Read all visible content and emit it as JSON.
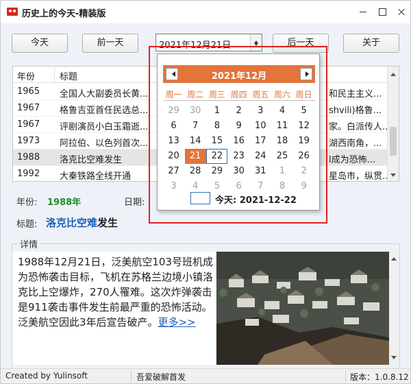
{
  "window": {
    "title": "历史上的今天-精装版"
  },
  "toolbar": {
    "today_label": "今天",
    "prev_label": "前一天",
    "date_value": "2021年12月21日",
    "next_label": "后一天",
    "about_label": "关于"
  },
  "table": {
    "headers": {
      "year": "年份",
      "title": "标题"
    },
    "rows": [
      {
        "year": "1965",
        "title": "全国人大副委员长黄...",
        "right": "和民主主义..."
      },
      {
        "year": "1967",
        "title": "格鲁吉亚首任民选总...",
        "right": "shvili)格鲁..."
      },
      {
        "year": "1967",
        "title": "评剧演员小白玉霜逝...",
        "right": "家。白派传人..."
      },
      {
        "year": "1973",
        "title": "阿拉伯、以色列首次...",
        "right": "湖西南角，..."
      },
      {
        "year": "1988",
        "title": "洛克比空难发生",
        "right": "l成为恐怖..."
      },
      {
        "year": "1992",
        "title": "大秦铁路全线开通",
        "right": "星岛市，纵贯..."
      }
    ],
    "selected_index": 4
  },
  "info": {
    "year_label": "年份:",
    "year_value": "1988年",
    "date_label": "日期:",
    "title_label": "标题:",
    "title_highlight": "洛克比空难",
    "title_rest": "发生"
  },
  "details": {
    "legend": "详情",
    "text": "1988年12月21日，泛美航空103号班机成为恐怖袭击目标，飞机在苏格兰边境小镇洛克比上空爆炸，270人罹难。这次炸弹袭击是911袭击事件发生前最严重的恐怖活动。泛美航空因此3年后宣告破产。",
    "more_link": "更多>>"
  },
  "statusbar": {
    "left": "Created by Yulinsoft",
    "middle": "吾爱破解首发",
    "right": "版本：1.0.8.12"
  },
  "calendar": {
    "title": "2021年12月",
    "weekdays": [
      "周一",
      "周二",
      "周三",
      "周四",
      "周五",
      "周六",
      "周日"
    ],
    "weeks": [
      [
        "29",
        "30",
        "1",
        "2",
        "3",
        "4",
        "5"
      ],
      [
        "6",
        "7",
        "8",
        "9",
        "10",
        "11",
        "12"
      ],
      [
        "13",
        "14",
        "15",
        "16",
        "17",
        "18",
        "19"
      ],
      [
        "20",
        "21",
        "22",
        "23",
        "24",
        "25",
        "26"
      ],
      [
        "27",
        "28",
        "29",
        "30",
        "31",
        "1",
        "2"
      ],
      [
        "3",
        "4",
        "5",
        "6",
        "7",
        "8",
        "9"
      ]
    ],
    "other_month_cells": [
      [
        0,
        0
      ],
      [
        0,
        1
      ],
      [
        4,
        5
      ],
      [
        4,
        6
      ],
      [
        5,
        0
      ],
      [
        5,
        1
      ],
      [
        5,
        2
      ],
      [
        5,
        3
      ],
      [
        5,
        4
      ],
      [
        5,
        5
      ],
      [
        5,
        6
      ]
    ],
    "selected_cell": [
      3,
      1
    ],
    "today_cell": [
      3,
      2
    ],
    "today_label": "今天: 2021-12-22"
  },
  "colors": {
    "accent": "#e3743a",
    "link": "#1a5fb8",
    "year_green": "#1f8c2f",
    "annotation_red": "#e21f1f"
  }
}
